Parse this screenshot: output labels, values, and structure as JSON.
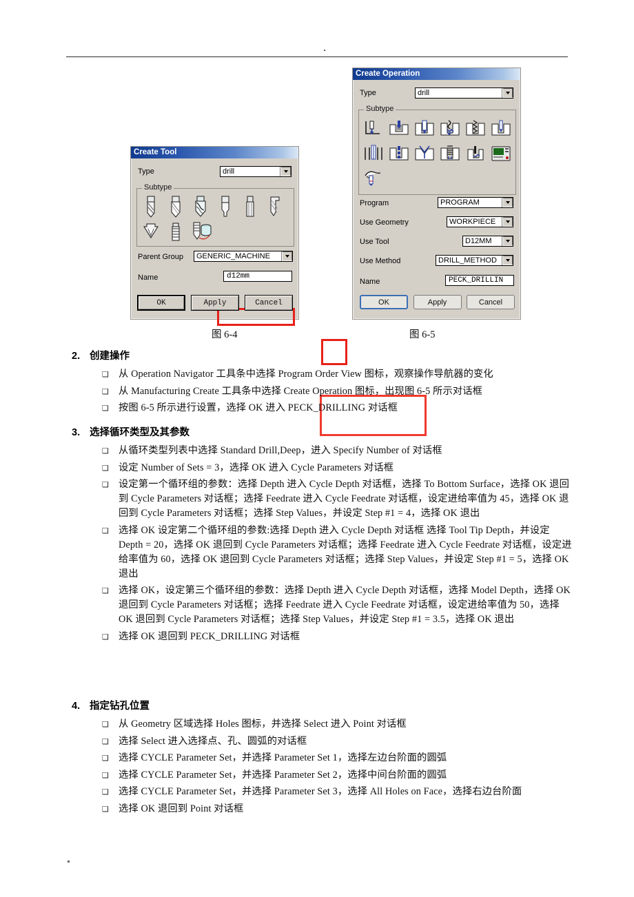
{
  "page": {
    "header_rule": true,
    "footer_mark": "."
  },
  "dialogs": {
    "create_tool": {
      "title": "Create Tool",
      "type_label": "Type",
      "type_value": "drill",
      "subtype_caption": "Subtype",
      "subtype_icons": [
        "twist-drill-icon",
        "spiral-flute-drill-icon",
        "step-drill-icon",
        "center-drill-icon",
        "reamer-icon",
        "counterbore-drill-icon",
        "countersink-icon",
        "tap-icon",
        "boring-bar-icon"
      ],
      "selected_subtype_index": 2,
      "parent_group_label": "Parent Group",
      "parent_group_value": "GENERIC_MACHINE",
      "name_label": "Name",
      "name_value": "d12mm",
      "buttons": [
        "OK",
        "Apply",
        "Cancel"
      ]
    },
    "create_operation": {
      "title": "Create Operation",
      "type_label": "Type",
      "type_value": "drill",
      "subtype_caption": "Subtype",
      "subtype_icons": [
        "spot-facing-icon",
        "spot-drilling-icon",
        "drilling-icon",
        "peck-drilling-icon",
        "break-chip-drilling-icon",
        "boring-icon",
        "reaming-icon",
        "counterboring-icon",
        "countersinking-icon",
        "tapping-icon",
        "hole-milling-icon",
        "machine-control-icon",
        "user-defined-drill-icon"
      ],
      "selected_subtype_index": 3,
      "fields": [
        {
          "label": "Program",
          "value": "PROGRAM",
          "control": "combo"
        },
        {
          "label": "Use Geometry",
          "value": "WORKPIECE",
          "control": "combo"
        },
        {
          "label": "Use Tool",
          "value": "D12MM",
          "control": "combo"
        },
        {
          "label": "Use Method",
          "value": "DRILL_METHOD",
          "control": "combo"
        },
        {
          "label": "Name",
          "value": "PECK_DRILLIN",
          "control": "text"
        }
      ],
      "buttons": [
        "OK",
        "Apply",
        "Cancel"
      ]
    }
  },
  "captions": {
    "fig_left": "图 6-4",
    "fig_right": "图 6-5"
  },
  "sections": [
    {
      "number": "2.",
      "title": "创建操作",
      "bullets": [
        "从 Operation Navigator 工具条中选择 Program Order View 图标，观察操作导航器的变化",
        "从 Manufacturing Create 工具条中选择 Create Operation 图标，出现图 6-5 所示对话框",
        "按图 6-5 所示进行设置，选择 OK 进入 PECK_DRILLING 对话框"
      ]
    },
    {
      "number": "3.",
      "title": "选择循环类型及其参数",
      "bullets": [
        "从循环类型列表中选择 Standard Drill,Deep，进入 Specify Number of 对话框",
        "设定 Number of Sets = 3，选择 OK 进入 Cycle Parameters 对话框",
        "设定第一个循环组的参数：选择 Depth 进入 Cycle Depth 对话框，选择 To Bottom Surface，选择 OK 退回到 Cycle Parameters 对话框；选择 Feedrate 进入 Cycle Feedrate 对话框，设定进给率值为 45，选择 OK 退回到 Cycle Parameters 对话框；选择 Step Values，并设定 Step #1 = 4，选择 OK 退出",
        "选择 OK 设定第二个循环组的参数:选择 Depth 进入 Cycle Depth 对话框 选择 Tool Tip Depth，并设定 Depth = 20，选择 OK 退回到 Cycle Parameters 对话框；选择 Feedrate 进入 Cycle Feedrate 对话框，设定进给率值为 60，选择 OK 退回到 Cycle Parameters 对话框；选择 Step Values，并设定 Step #1 = 5，选择 OK 退出",
        "选择 OK，设定第三个循环组的参数：选择 Depth 进入 Cycle Depth 对话框，选择 Model Depth，选择 OK 退回到 Cycle Parameters 对话框；选择 Feedrate 进入 Cycle Feedrate 对话框，设定进给率值为 50，选择 OK 退回到 Cycle Parameters 对话框；选择 Step Values，并设定 Step #1 = 3.5，选择 OK 退出",
        "选择 OK 退回到 PECK_DRILLING 对话框"
      ],
      "bold_leads": [
        "",
        "",
        "设定第一个循环组的参数：",
        "设定第二个循环组的参数:",
        "设定第三个循环组的参数："
      ]
    },
    {
      "number": "4.",
      "title": "指定钻孔位置",
      "bullets": [
        "从 Geometry 区域选择 Holes 图标，并选择 Select 进入 Point 对话框",
        "选择 Select 进入选择点、孔、圆弧的对话框",
        "选择 CYCLE Parameter Set，并选择 Parameter Set 1，选择左边台阶面的圆弧",
        "选择 CYCLE Parameter Set，并选择 Parameter Set 2，选择中间台阶面的圆弧",
        "选择 CYCLE Parameter Set，并选择 Parameter Set 3，选择 All Holes on Face，选择右边台阶面",
        "选择 OK 退回到 Point 对话框"
      ]
    }
  ],
  "colors": {
    "highlight": "#e8201a",
    "dialog_face": "#d4d0c8",
    "titlebar_start": "#103a8e",
    "titlebar_end": "#dce8f6"
  }
}
